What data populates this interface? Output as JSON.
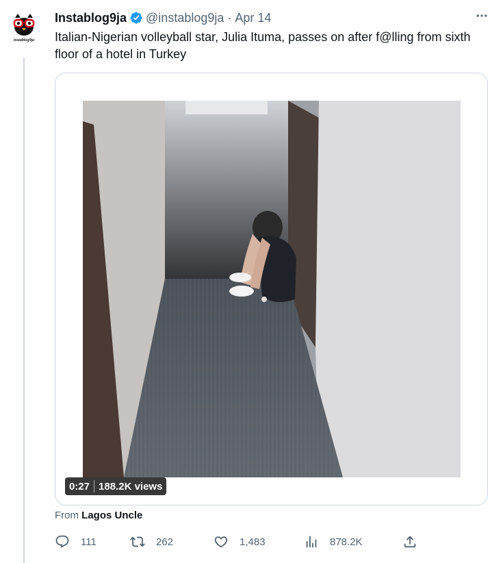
{
  "tweet": {
    "avatar_text": "instablog9ja",
    "author_name": "Instablog9ja",
    "handle": "@instablog9ja",
    "separator": "·",
    "date": "Apr 14",
    "text": "Italian-Nigerian volleyball star, Julia Ituma, passes on after f@lling from sixth floor  of a hotel in Turkey",
    "more_icon": "more-horizontal-icon",
    "verified_icon": "verified-badge-icon"
  },
  "media": {
    "duration": "0:27",
    "views": "188.2K views"
  },
  "source": {
    "prefix": "From",
    "name": "Lagos Uncle"
  },
  "actions": {
    "reply_count": "111",
    "retweet_count": "262",
    "like_count": "1,483",
    "view_count": "878.2K"
  },
  "colors": {
    "text": "#0f1419",
    "muted": "#536471",
    "border": "#cfd9de",
    "verified": "#1d9bf0"
  }
}
